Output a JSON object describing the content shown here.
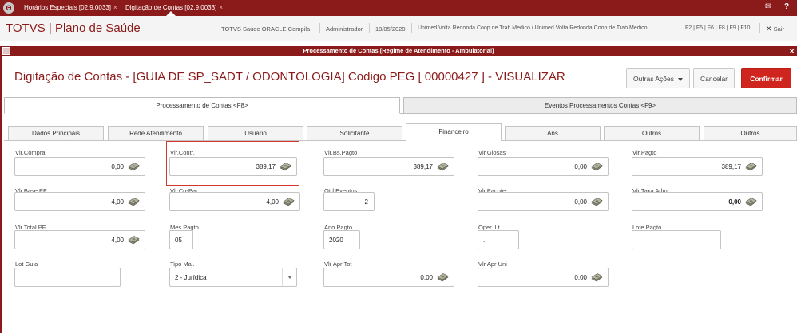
{
  "titlebar": {
    "logo_glyph": "Θ",
    "tabs": [
      {
        "label": "Horários Especiais [02.9.0033]",
        "close": "×"
      },
      {
        "label": "Digitação de Contas [02.9.0033]",
        "close": "×"
      }
    ],
    "mail_glyph": "✉",
    "help_glyph": "?"
  },
  "header": {
    "app_title": "TOTVS | Plano de Saúde",
    "environment": "TOTVS Saúde ORACLE Compila",
    "user": "Administrador",
    "date": "18/05/2020",
    "company": "Unimed Volta Redonda Coop de Trab Medico / Unimed Volta Redonda Coop de Trab Medico",
    "shortcuts": "F2 | F5 | F6 | F8 | F9 | F10",
    "exit_label": "Sair",
    "exit_glyph": "✕"
  },
  "dialog": {
    "title": "Processamento de Contas [Regime de Atendimento - Ambulatorial]",
    "close_glyph": "✕"
  },
  "page": {
    "title": "Digitação de Contas -  [GUIA DE SP_SADT / ODONTOLOGIA]   Codigo PEG [ 00000427 ] - VISUALIZAR",
    "buttons": {
      "other_actions": "Outras Ações",
      "cancel": "Cancelar",
      "confirm": "Confirmar"
    }
  },
  "main_tabs": [
    {
      "label": "Processamento de Contas <F8>",
      "active": true
    },
    {
      "label": "Eventos Processamentos Contas <F9>",
      "active": false
    }
  ],
  "sub_tabs": [
    {
      "label": "Dados Principais"
    },
    {
      "label": "Rede Atendimento"
    },
    {
      "label": "Usuario"
    },
    {
      "label": "Solicitante"
    },
    {
      "label": "Financeiro",
      "active": true
    },
    {
      "label": "Ans"
    },
    {
      "label": "Outros"
    },
    {
      "label": "Outros"
    }
  ],
  "fields": {
    "vlr_compra": {
      "label": "Vlr.Compra",
      "value": "0,00"
    },
    "vlr_contr": {
      "label": "Vlr.Contr.",
      "value": "389,17"
    },
    "vlr_bs_pagto": {
      "label": "Vlr.Bs.Pagto",
      "value": "389,17"
    },
    "vlr_glosas": {
      "label": "Vlr.Glosas",
      "value": "0,00"
    },
    "vlr_pagto": {
      "label": "Vlr.Pagto",
      "value": "389,17"
    },
    "vlr_base_pf": {
      "label": "Vlr.Base PF",
      "value": "4,00"
    },
    "vlr_co_par": {
      "label": "Vlr.Co-Par",
      "value": "4,00"
    },
    "qtd_eventos": {
      "label": "Qtd Eventos",
      "value": "2"
    },
    "vlr_pacote": {
      "label": "Vlr.Pacote",
      "value": "0,00"
    },
    "vlr_taxa_adm": {
      "label": "Vlr.Taxa Adm",
      "value": "0,00"
    },
    "vlr_total_pf": {
      "label": "Vlr.Total PF",
      "value": "4,00"
    },
    "mes_pagto": {
      "label": "Mes Pagto",
      "value": "05"
    },
    "ano_pagto": {
      "label": "Ano Pagto",
      "value": "2020"
    },
    "oper_lt": {
      "label": "Oper. Lt.",
      "value": "."
    },
    "lote_pagto": {
      "label": "Lote Pagto",
      "value": ""
    },
    "lot_guia": {
      "label": "Lot Guia",
      "value": ""
    },
    "tipo_maj": {
      "label": "Tipo Maj.",
      "value": "2 - Jurídica"
    },
    "vlr_apr_tot": {
      "label": "Vlr Apr Tot",
      "value": "0,00"
    },
    "vlr_apr_uni": {
      "label": "Vlr Apr Uni",
      "value": "0,00"
    }
  },
  "colors": {
    "brand": "#8b1a1a",
    "confirm": "#d0241f",
    "highlight": "#d4362e"
  }
}
